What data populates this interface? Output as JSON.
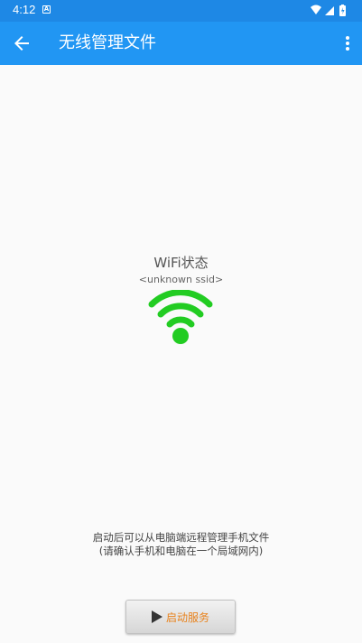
{
  "status_bar": {
    "time": "4:12",
    "notification_icon": "A"
  },
  "app_bar": {
    "back_icon": "arrow-back-icon",
    "title": "无线管理文件",
    "menu_icon": "more-vert-icon"
  },
  "wifi": {
    "title": "WiFi状态",
    "ssid": "<unknown ssid>",
    "icon": "wifi-icon",
    "icon_color": "#22cc22"
  },
  "description": {
    "line1": "启动后可以从电脑端远程管理手机文件",
    "line2": "(请确认手机和电脑在一个局域网内)"
  },
  "start_button": {
    "label": "启动服务",
    "icon": "play-icon",
    "label_color": "#e8821c"
  },
  "colors": {
    "status_bar": "#1e88e5",
    "app_bar": "#2196f3",
    "background": "#fafafa"
  }
}
